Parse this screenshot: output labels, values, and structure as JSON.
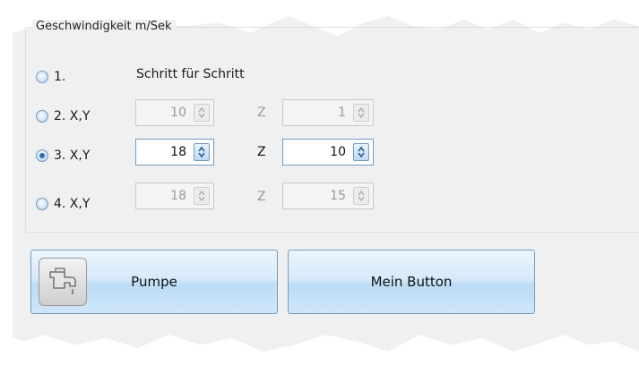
{
  "group": {
    "title": "Geschwindigkeit m/Sek"
  },
  "heading": "Schritt für Schritt",
  "options": [
    {
      "label": "1.",
      "checked": false
    },
    {
      "label": "2. X,Y",
      "checked": false,
      "xy": "10",
      "z_label": "Z",
      "z": "1"
    },
    {
      "label": "3. X,Y",
      "checked": true,
      "xy": "18",
      "z_label": "Z",
      "z": "10"
    },
    {
      "label": "4. X,Y",
      "checked": false,
      "xy": "18",
      "z_label": "Z",
      "z": "15"
    }
  ],
  "buttons": {
    "pumpe": "Pumpe",
    "mein_button": "Mein Button"
  },
  "icons": {
    "pumpe": "water-tap-icon",
    "spin": "spin-up-down-icon"
  },
  "colors": {
    "panel": "#f0f0f0",
    "accent_border": "#6f9ec4",
    "button_face": "#cfe6f9"
  }
}
